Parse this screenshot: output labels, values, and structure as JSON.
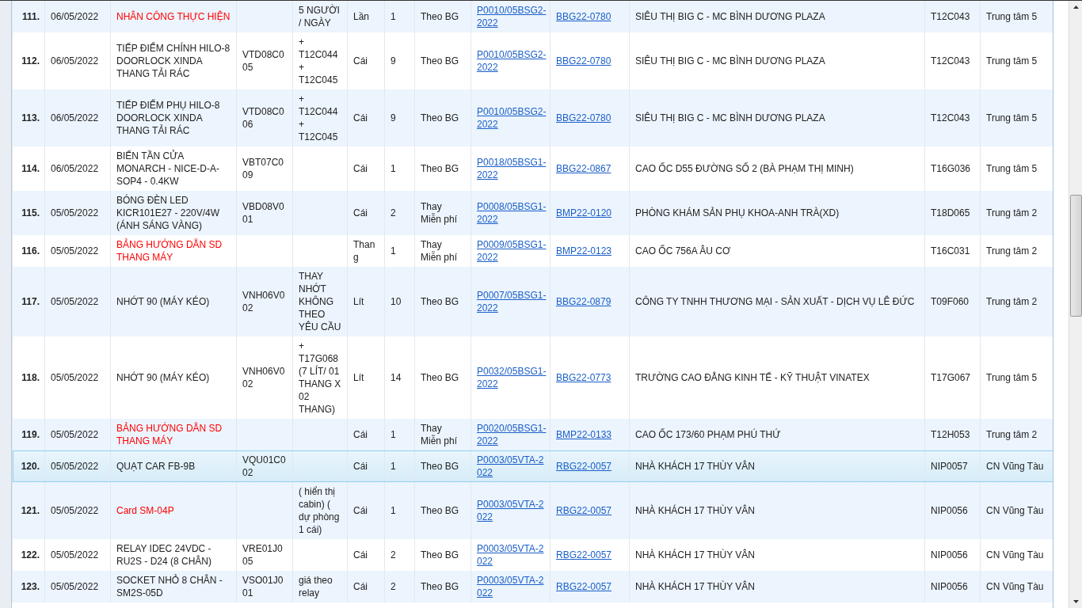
{
  "table": {
    "rows": [
      {
        "selected": false,
        "alert": true,
        "column_1": "111.",
        "column_2": "06/05/2022",
        "column_3": "NHÂN CÔNG THỰC HIỆN",
        "column_5": "5 NGƯỜI / NGÀY",
        "column_6": "Lần",
        "column_7": "1",
        "column_8": "Theo BG",
        "column_9": "P0010/05BSG2-2022",
        "column_10": "BBG22-0780",
        "column_11": "SIÊU THỊ BIG C - MC BÌNH DƯƠNG PLAZA",
        "column_12": "T12C043",
        "column_13": "Trung tâm 5"
      },
      {
        "selected": false,
        "alert": false,
        "column_1": "112.",
        "column_2": "06/05/2022",
        "column_3": "TIẾP ĐIỂM CHÍNH HILO-8 DOORLOCK XINDA THANG TẢI RÁC",
        "column_4": "VTD08C005",
        "column_5": "+ T12C044 + T12C045",
        "column_6": "Cái",
        "column_7": "9",
        "column_8": "Theo BG",
        "column_9": "P0010/05BSG2-2022",
        "column_10": "BBG22-0780",
        "column_11": "SIÊU THỊ BIG C - MC BÌNH DƯƠNG PLAZA",
        "column_12": "T12C043",
        "column_13": "Trung tâm 5"
      },
      {
        "selected": false,
        "alert": false,
        "column_1": "113.",
        "column_2": "06/05/2022",
        "column_3": "TIẾP ĐIỂM PHỤ HILO-8 DOORLOCK XINDA THANG TẢI RÁC",
        "column_4": "VTD08C006",
        "column_5": "+ T12C044 + T12C045",
        "column_6": "Cái",
        "column_7": "9",
        "column_8": "Theo BG",
        "column_9": "P0010/05BSG2-2022",
        "column_10": "BBG22-0780",
        "column_11": "SIÊU THỊ BIG C - MC BÌNH DƯƠNG PLAZA",
        "column_12": "T12C043",
        "column_13": "Trung tâm 5"
      },
      {
        "selected": false,
        "alert": false,
        "column_1": "114.",
        "column_2": "06/05/2022",
        "column_3": "BIẾN TẦN CỬA MONARCH - NICE-D-A-SOP4 - 0.4KW",
        "column_4": "VBT07C009",
        "column_6": "Cái",
        "column_7": "1",
        "column_8": "Theo BG",
        "column_9": "P0018/05BSG1-2022",
        "column_10": "BBG22-0867",
        "column_11": "CAO ỐC D55 ĐƯỜNG SỐ 2 (BÀ PHẠM THỊ MINH)",
        "column_12": "T16G036",
        "column_13": "Trung tâm 5"
      },
      {
        "selected": false,
        "alert": false,
        "column_1": "115.",
        "column_2": "05/05/2022",
        "column_3": "BÓNG ĐÈN LED KICR101E27 - 220V/4W (ÁNH SÁNG VÀNG)",
        "column_4": "VBD08V001",
        "column_6": "Cái",
        "column_7": "2",
        "column_8": "Thay Miễn phí",
        "column_9": "P0008/05BSG1-2022",
        "column_10": "BMP22-0120",
        "column_11": "PHÒNG KHÁM SẢN PHỤ KHOA-ANH TRÀ(XD)",
        "column_12": "T18D065",
        "column_13": "Trung tâm 2"
      },
      {
        "selected": false,
        "alert": true,
        "column_1": "116.",
        "column_2": "05/05/2022",
        "column_3": "BẢNG HƯỚNG DẪN SD THANG MÁY",
        "column_6": "Thang",
        "column_7": "1",
        "column_8": "Thay Miễn phí",
        "column_9": "P0009/05BSG1-2022",
        "column_10": "BMP22-0123",
        "column_11": "CAO ỐC 756A ÂU CƠ",
        "column_12": "T16C031",
        "column_13": "Trung tâm 2"
      },
      {
        "selected": false,
        "alert": false,
        "column_1": "117.",
        "column_2": "05/05/2022",
        "column_3": "NHỚT 90 (MÁY KÉO)",
        "column_4": "VNH06V002",
        "column_5": "THAY NHỚT KHÔNG THEO YÊU CẦU",
        "column_6": "Lít",
        "column_7": "10",
        "column_8": "Theo BG",
        "column_9": "P0007/05BSG1-2022",
        "column_10": "BBG22-0879",
        "column_11": "CÔNG TY TNHH THƯƠNG MẠI - SẢN XUẤT - DỊCH VỤ LÊ ĐỨC",
        "column_12": "T09F060",
        "column_13": "Trung tâm 2"
      },
      {
        "selected": false,
        "alert": false,
        "column_1": "118.",
        "column_2": "05/05/2022",
        "column_3": "NHỚT 90 (MÁY KÉO)",
        "column_4": "VNH06V002",
        "column_5": "+ T17G068 (7 LÍT/ 01 THANG X 02 THANG)",
        "column_6": "Lít",
        "column_7": "14",
        "column_8": "Theo BG",
        "column_9": "P0032/05BSG1-2022",
        "column_10": "BBG22-0773",
        "column_11": "TRƯỜNG CAO ĐẲNG KINH TẾ - KỸ THUẬT VINATEX",
        "column_12": "T17G067",
        "column_13": "Trung tâm 5"
      },
      {
        "selected": false,
        "alert": true,
        "column_1": "119.",
        "column_2": "05/05/2022",
        "column_3": "BẢNG HƯỚNG DẪN SD THANG MÁY",
        "column_6": "Cái",
        "column_7": "1",
        "column_8": "Thay Miễn phí",
        "column_9": "P0020/05BSG1-2022",
        "column_10": "BMP22-0133",
        "column_11": "CAO ỐC 173/60 PHẠM PHÚ THỨ",
        "column_12": "T12H053",
        "column_13": "Trung tâm 2"
      },
      {
        "selected": true,
        "alert": false,
        "column_1": "120.",
        "column_2": "05/05/2022",
        "column_3": "QUẠT CAR FB-9B",
        "column_4": "VQU01C002",
        "column_6": "Cái",
        "column_7": "1",
        "column_8": "Theo BG",
        "column_9": "P0003/05VTA-2022",
        "column_10": "RBG22-0057",
        "column_11": "NHÀ KHÁCH 17 THÙY VÂN",
        "column_12": "NIP0057",
        "column_13": "CN Vũng Tàu"
      },
      {
        "selected": false,
        "alert": true,
        "column_1": "121.",
        "column_2": "05/05/2022",
        "column_3": "Card SM-04P",
        "column_5": "( hiển thị cabin) ( dự phòng 1 cái)",
        "column_6": "Cái",
        "column_7": "1",
        "column_8": "Theo BG",
        "column_9": "P0003/05VTA-2022",
        "column_10": "RBG22-0057",
        "column_11": "NHÀ KHÁCH 17 THÙY VÂN",
        "column_12": "NIP0056",
        "column_13": "CN Vũng Tàu"
      },
      {
        "selected": false,
        "alert": false,
        "column_1": "122.",
        "column_2": "05/05/2022",
        "column_3": "RELAY IDEC 24VDC - RU2S - D24 (8 CHÂN)",
        "column_4": "VRE01J005",
        "column_6": "Cái",
        "column_7": "2",
        "column_8": "Theo BG",
        "column_9": "P0003/05VTA-2022",
        "column_10": "RBG22-0057",
        "column_11": "NHÀ KHÁCH 17 THÙY VÂN",
        "column_12": "NIP0056",
        "column_13": "CN Vũng Tàu"
      },
      {
        "selected": false,
        "alert": false,
        "column_1": "123.",
        "column_2": "05/05/2022",
        "column_3": "SOCKET NHỎ 8 CHÂN - SM2S-05D",
        "column_4": "VSO01J001",
        "column_5": "giá theo relay",
        "column_6": "Cái",
        "column_7": "2",
        "column_8": "Theo BG",
        "column_9": "P0003/05VTA-2022",
        "column_10": "RBG22-0057",
        "column_11": "NHÀ KHÁCH 17 THÙY VÂN",
        "column_12": "NIP0056",
        "column_13": "CN Vũng Tàu"
      }
    ]
  }
}
